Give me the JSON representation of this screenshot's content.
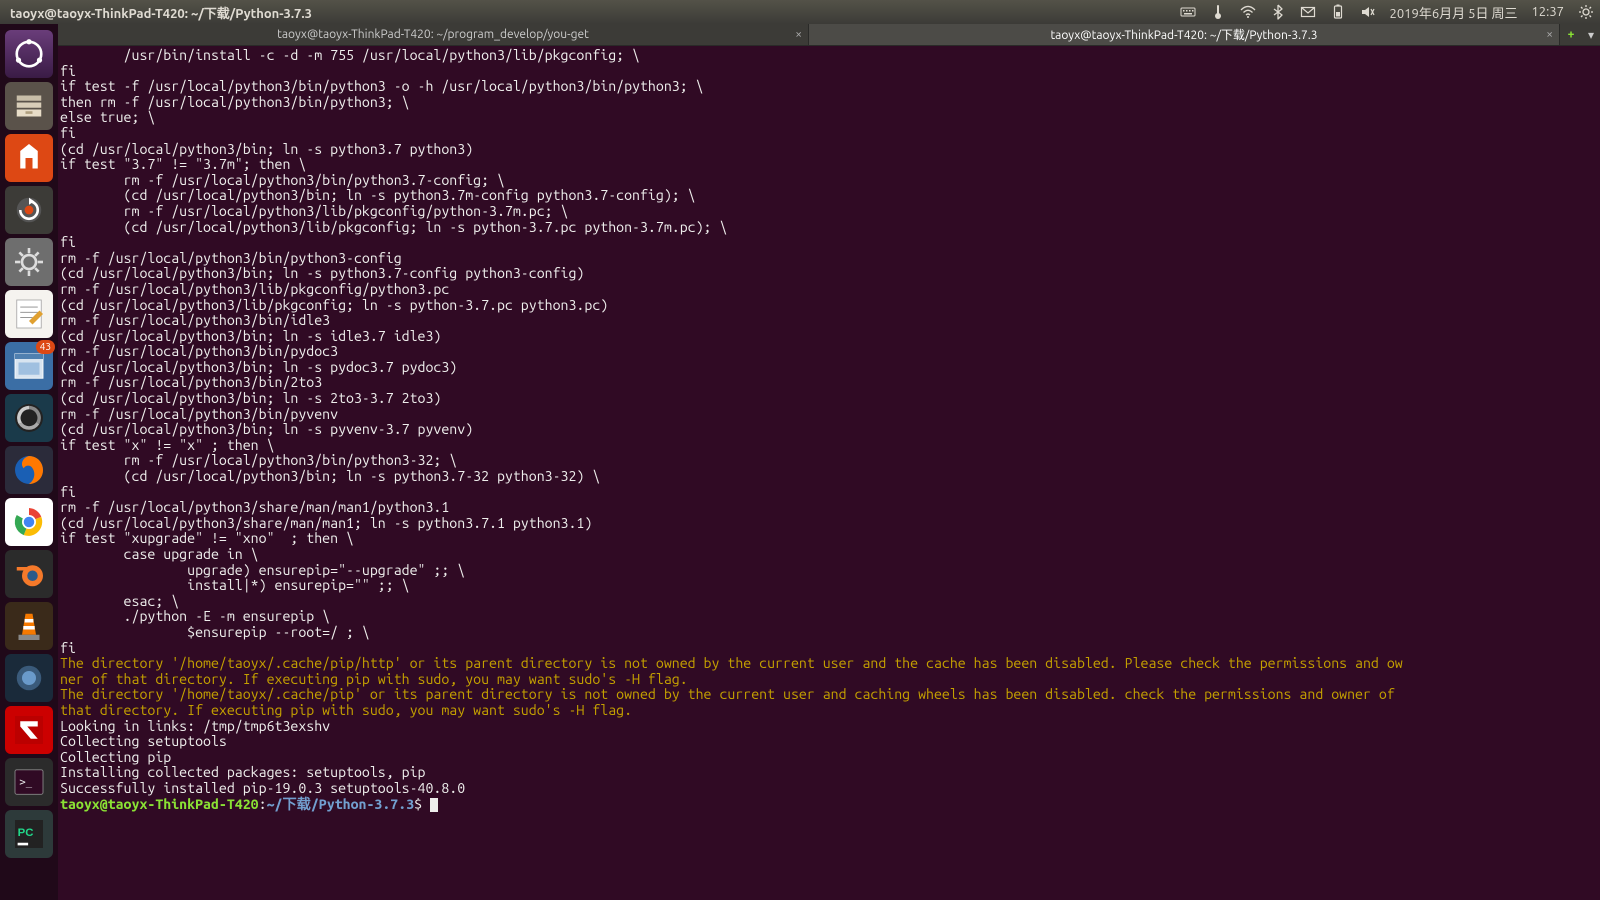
{
  "panel": {
    "window_title": "taoyx@taoyx-ThinkPad-T420: ~/下载/Python-3.7.3",
    "date": "2019年6月月 5日 周三",
    "time": "12:37"
  },
  "launcher": {
    "badge_updates": "43"
  },
  "tabs": {
    "tab1": "taoyx@taoyx-ThinkPad-T420: ~/program_develop/you-get",
    "tab2": "taoyx@taoyx-ThinkPad-T420: ~/下载/Python-3.7.3",
    "add": "+",
    "menu": "▾"
  },
  "terminal": {
    "lines": "        /usr/bin/install -c -d -m 755 /usr/local/python3/lib/pkgconfig; \\\nfi\nif test -f /usr/local/python3/bin/python3 -o -h /usr/local/python3/bin/python3; \\\nthen rm -f /usr/local/python3/bin/python3; \\\nelse true; \\\nfi\n(cd /usr/local/python3/bin; ln -s python3.7 python3)\nif test \"3.7\" != \"3.7m\"; then \\\n        rm -f /usr/local/python3/bin/python3.7-config; \\\n        (cd /usr/local/python3/bin; ln -s python3.7m-config python3.7-config); \\\n        rm -f /usr/local/python3/lib/pkgconfig/python-3.7m.pc; \\\n        (cd /usr/local/python3/lib/pkgconfig; ln -s python-3.7.pc python-3.7m.pc); \\\nfi\nrm -f /usr/local/python3/bin/python3-config\n(cd /usr/local/python3/bin; ln -s python3.7-config python3-config)\nrm -f /usr/local/python3/lib/pkgconfig/python3.pc\n(cd /usr/local/python3/lib/pkgconfig; ln -s python-3.7.pc python3.pc)\nrm -f /usr/local/python3/bin/idle3\n(cd /usr/local/python3/bin; ln -s idle3.7 idle3)\nrm -f /usr/local/python3/bin/pydoc3\n(cd /usr/local/python3/bin; ln -s pydoc3.7 pydoc3)\nrm -f /usr/local/python3/bin/2to3\n(cd /usr/local/python3/bin; ln -s 2to3-3.7 2to3)\nrm -f /usr/local/python3/bin/pyvenv\n(cd /usr/local/python3/bin; ln -s pyvenv-3.7 pyvenv)\nif test \"x\" != \"x\" ; then \\\n        rm -f /usr/local/python3/bin/python3-32; \\\n        (cd /usr/local/python3/bin; ln -s python3.7-32 python3-32) \\\nfi\nrm -f /usr/local/python3/share/man/man1/python3.1\n(cd /usr/local/python3/share/man/man1; ln -s python3.7.1 python3.1)\nif test \"xupgrade\" != \"xno\"  ; then \\\n        case upgrade in \\\n                upgrade) ensurepip=\"--upgrade\" ;; \\\n                install|*) ensurepip=\"\" ;; \\\n        esac; \\\n        ./python -E -m ensurepip \\\n                $ensurepip --root=/ ; \\\nfi",
    "warn1": "The directory '/home/taoyx/.cache/pip/http' or its parent directory is not owned by the current user and the cache has been disabled. Please check the permissions and ow\nner of that directory. If executing pip with sudo, you may want sudo's -H flag.",
    "warn2": "The directory '/home/taoyx/.cache/pip' or its parent directory is not owned by the current user and caching wheels has been disabled. check the permissions and owner of \nthat directory. If executing pip with sudo, you may want sudo's -H flag.",
    "tail": "Looking in links: /tmp/tmp6t3exshv\nCollecting setuptools\nCollecting pip\nInstalling collected packages: setuptools, pip\nSuccessfully installed pip-19.0.3 setuptools-40.8.0",
    "prompt_user": "taoyx@taoyx-ThinkPad-T420",
    "prompt_sep": ":",
    "prompt_path": "~/下载/Python-3.7.3",
    "prompt_end": "$ "
  }
}
